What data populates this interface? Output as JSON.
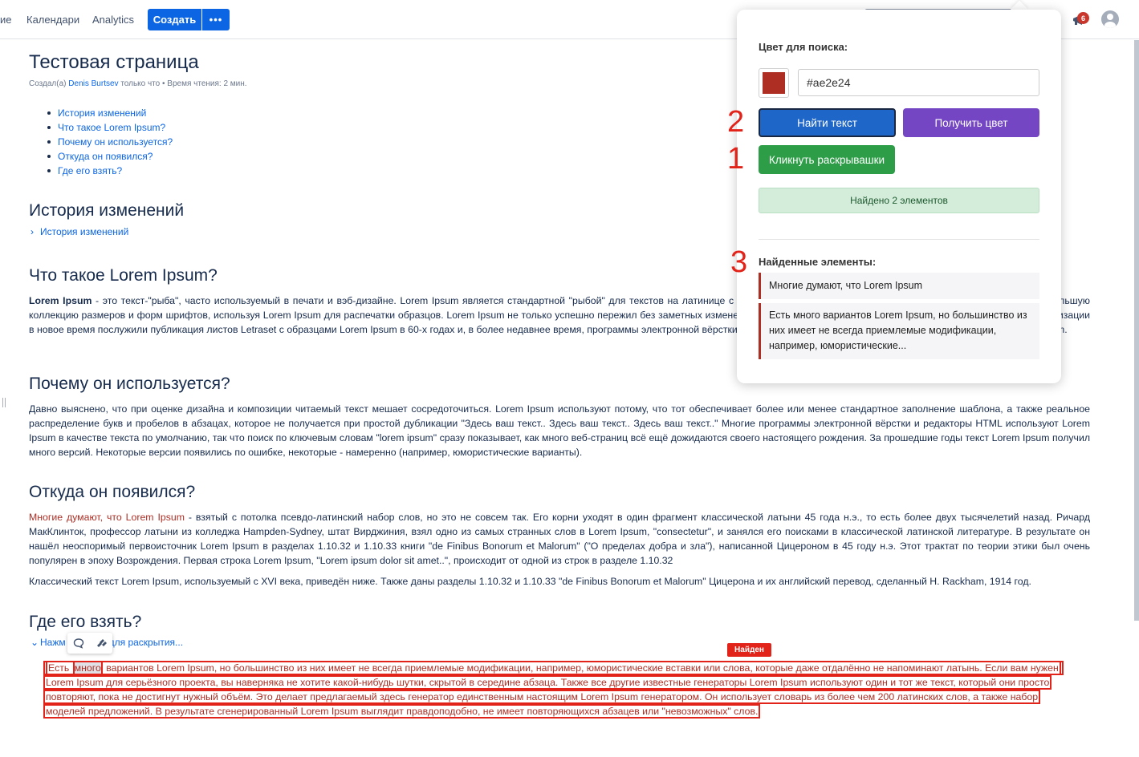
{
  "topnav": {
    "partial_link": "ие",
    "calendars": "Календари",
    "analytics": "Analytics",
    "create_label": "Создать",
    "more_label": "•••",
    "notif_count": "6"
  },
  "page": {
    "title": "Тестовая страница",
    "byline_prefix": "Создал(а)",
    "byline_author": "Denis Burtsev",
    "byline_suffix": "только что • Время чтения: 2 мин.",
    "toc": [
      "История изменений",
      "Что такое Lorem Ipsum?",
      "Почему он используется?",
      "Откуда он появился?",
      "Где его взять?"
    ],
    "sec1_title": "История изменений",
    "sec1_expand": "История изменений",
    "sec2_title": "Что такое Lorem Ipsum?",
    "sec2_bold": "Lorem Ipsum",
    "sec2_text": " - это текст-\"рыба\", часто используемый в печати и вэб-дизайне. Lorem Ipsum является стандартной \"рыбой\" для текстов на латинице с начала XVI века. В то время некий безымянный печатник создал большую коллекцию размеров и форм шрифтов, используя Lorem Ipsum для распечатки образцов. Lorem Ipsum не только успешно пережил без заметных изменений пять веков, но и перешагнул в электронный дизайн. Его популяризации в новое время послужили публикация листов Letraset с образцами Lorem Ipsum в 60-х годах и, в более недавнее время, программы электронной вёрстки типа Aldus PageMaker, в шаблонах которых используется Lorem Ipsum.",
    "sec3_title": "Почему он используется?",
    "sec3_text": "Давно выяснено, что при оценке дизайна и композиции читаемый текст мешает сосредоточиться. Lorem Ipsum используют потому, что тот обеспечивает более или менее стандартное заполнение шаблона, а также реальное распределение букв и пробелов в абзацах, которое не получается при простой дубликации \"Здесь ваш текст.. Здесь ваш текст.. Здесь ваш текст..\" Многие программы электронной вёрстки и редакторы HTML используют Lorem Ipsum в качестве текста по умолчанию, так что поиск по ключевым словам \"lorem ipsum\" сразу показывает, как много веб-страниц всё ещё дожидаются своего настоящего рождения. За прошедшие годы текст Lorem Ipsum получил много версий. Некоторые версии появились по ошибке, некоторые - намеренно (например, юмористические варианты).",
    "sec4_title": "Откуда он появился?",
    "sec4_red": "Многие думают, что Lorem Ipsum",
    "sec4_text": " - взятый с потолка псевдо-латинский набор слов, но это не совсем так. Его корни уходят в один фрагмент классической латыни 45 года н.э., то есть более двух тысячелетий назад. Ричард МакКлинток, профессор латыни из колледжа Hampden-Sydney, штат Вирджиния, взял одно из самых странных слов в Lorem Ipsum, \"consectetur\", и занялся его поисками в классической латинской литературе. В результате он нашёл неоспоримый первоисточник Lorem Ipsum в разделах 1.10.32 и 1.10.33 книги \"de Finibus Bonorum et Malorum\" (\"О пределах добра и зла\"), написанной Цицероном в 45 году н.э. Этот трактат по теории этики был очень популярен в эпоху Возрождения. Первая строка Lorem Ipsum, \"Lorem ipsum dolor sit amet..\", происходит от одной из строк в разделе 1.10.32",
    "sec4_text2": "Классический текст Lorem Ipsum, используемый с XVI века, приведён ниже. Также даны разделы 1.10.32 и 1.10.33 \"de Finibus Bonorum et Malorum\" Цицерона и их английский перевод, сделанный H. Rackham, 1914 год.",
    "sec5_title": "Где его взять?",
    "sec5_expand_a": "Нажм",
    "sec5_expand_b": "для раскрытия...",
    "found_badge": "Найден",
    "found_l1_pre": "Есть ",
    "found_l1_hl": "много",
    "found_l1_post": " вариантов Lorem Ipsum, но большинство из них имеет не всегда приемлемые модификации, например, юмористические вставки или слова, которые даже отдалённо не напоминают латынь. Если вам нужен",
    "found_l2": "Lorem Ipsum для серьёзного проекта, вы наверняка не хотите какой-нибудь шутки, скрытой в середине абзаца. Также все другие известные генераторы Lorem Ipsum используют один и тот же текст, который они просто",
    "found_l3": "повторяют, пока не достигнут нужный объём. Это делает предлагаемый здесь генератор единственным настоящим Lorem Ipsum генератором. Он использует словарь из более чем 200 латинских слов, а также набор",
    "found_l4": "моделей предложений. В результате сгенерированный Lorem Ipsum выглядит правдоподобно, не имеет повторяющихся абзацев или \"невозможных\" слов."
  },
  "popup": {
    "color_label": "Цвет для поиска:",
    "swatch_color": "#ae2e24",
    "hex_value": "#ae2e24",
    "find_button": "Найти текст",
    "get_color_button": "Получить цвет",
    "click_expanders_button": "Кликнуть раскрывашки",
    "status_text": "Найдено 2 элементов",
    "found_title": "Найденные элементы:",
    "results": [
      "Многие думают, что Lorem Ipsum",
      "Есть много вариантов Lorem Ipsum, но большинство из них имеет не всегда приемлемые модификации, например, юмористические..."
    ]
  },
  "annotations": {
    "n1": "1",
    "n2": "2",
    "n3": "3"
  }
}
